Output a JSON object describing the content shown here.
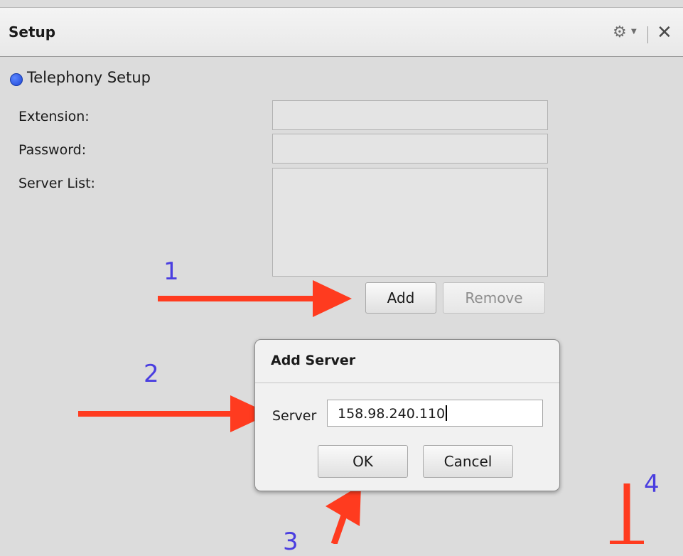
{
  "panel": {
    "title": "Setup",
    "gear_icon": "gear-icon",
    "close_icon": "close-icon"
  },
  "section": {
    "title": "Telephony Setup",
    "indicator_color": "#1f46d6"
  },
  "form": {
    "extension_label": "Extension:",
    "extension_value": "",
    "password_label": "Password:",
    "password_value": "",
    "server_list_label": "Server List:",
    "server_list_items": [],
    "add_label": "Add",
    "remove_label": "Remove"
  },
  "dialog": {
    "title": "Add Server",
    "server_label": "Server",
    "server_value": "158.98.240.110",
    "ok_label": "OK",
    "cancel_label": "Cancel"
  },
  "annotations": {
    "step1": "1",
    "step2": "2",
    "step3": "3",
    "step4": "4",
    "arrow_color": "#ff3b1f",
    "number_color": "#4a3ee0"
  }
}
